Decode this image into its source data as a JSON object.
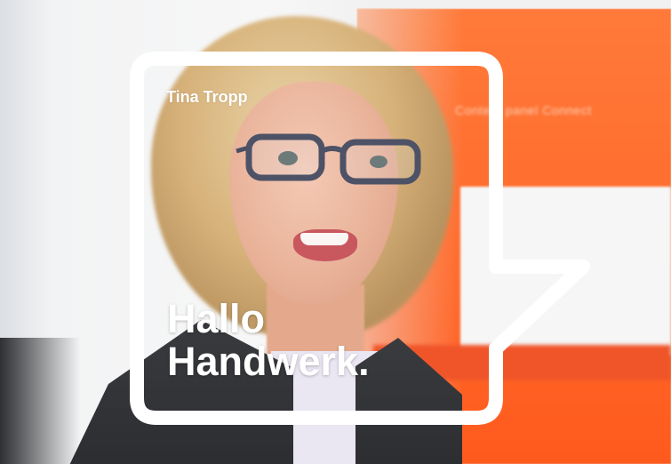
{
  "photo": {
    "subject": "woman-with-glasses-portrait",
    "background_accent": "#ff6a2a",
    "background_text": "Content panel Connect"
  },
  "frame": {
    "color": "#ffffff",
    "shape": "speech-bubble"
  },
  "caption": {
    "name": "Tina Tropp"
  },
  "headline": {
    "line1": "Hallo",
    "line2": "Handwerk."
  }
}
